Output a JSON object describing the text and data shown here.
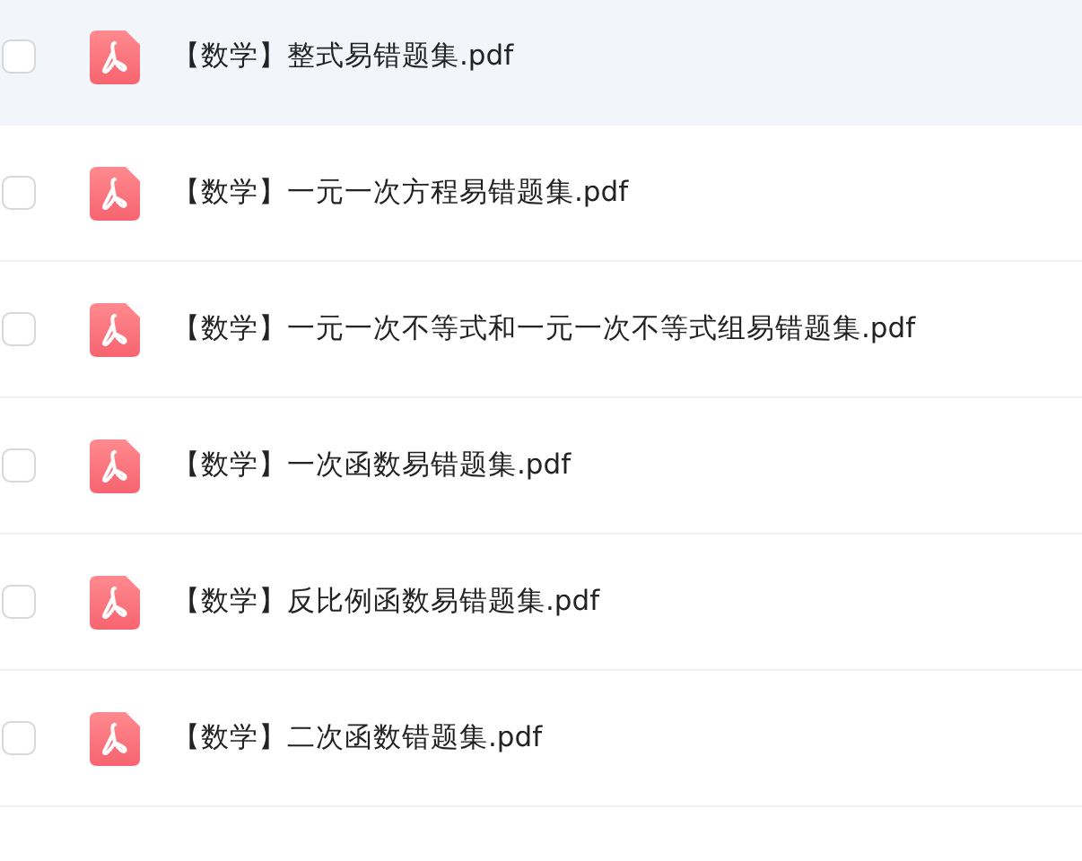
{
  "files": [
    {
      "name": "【数学】整式易错题集.pdf",
      "checked": false,
      "selected": true
    },
    {
      "name": "【数学】一元一次方程易错题集.pdf",
      "checked": false,
      "selected": false
    },
    {
      "name": "【数学】一元一次不等式和一元一次不等式组易错题集.pdf",
      "checked": false,
      "selected": false
    },
    {
      "name": "【数学】一次函数易错题集.pdf",
      "checked": false,
      "selected": false
    },
    {
      "name": "【数学】反比例函数易错题集.pdf",
      "checked": false,
      "selected": false
    },
    {
      "name": "【数学】二次函数错题集.pdf",
      "checked": false,
      "selected": false
    }
  ]
}
